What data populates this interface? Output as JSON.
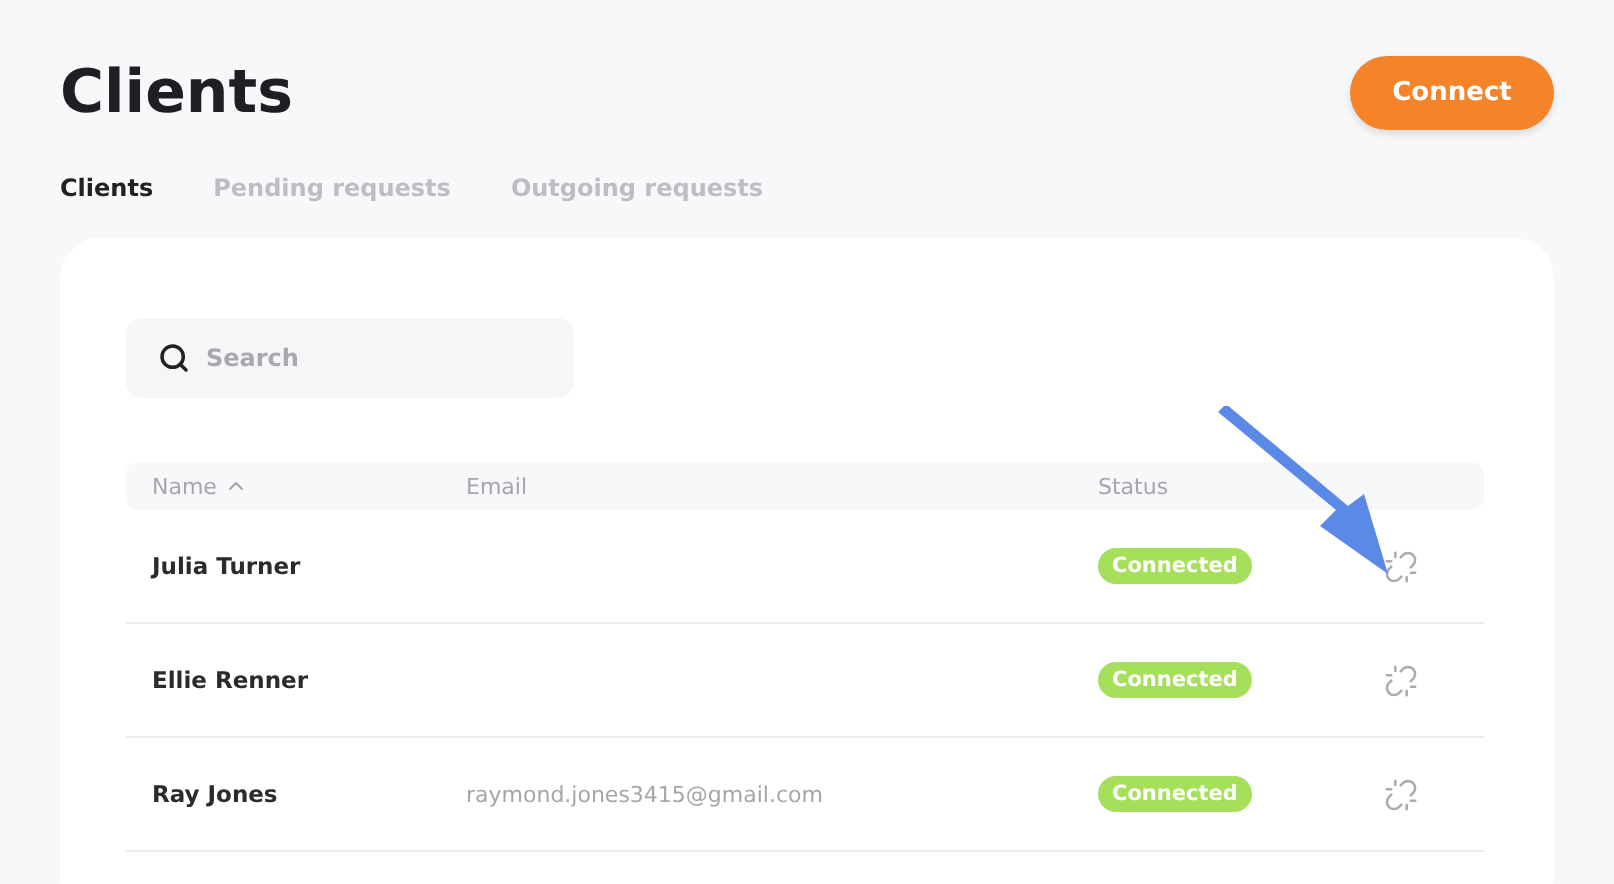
{
  "page": {
    "title": "Clients"
  },
  "connect_button": "Connect",
  "tabs": [
    {
      "label": "Clients",
      "selected": true
    },
    {
      "label": "Pending requests",
      "selected": false
    },
    {
      "label": "Outgoing requests",
      "selected": false
    }
  ],
  "search": {
    "placeholder": "Search"
  },
  "table": {
    "columns": [
      {
        "label": "Name",
        "sorted": true
      },
      {
        "label": "Email",
        "sorted": false
      },
      {
        "label": "Status",
        "sorted": false
      }
    ],
    "rows": [
      {
        "name": "Julia Turner",
        "status": "Connected"
      },
      {
        "name": "Ellie Renner",
        "status": "Connected"
      },
      {
        "name": "Ray Jones",
        "email": "raymond.jones3415@gmail.com",
        "status": "Connected"
      }
    ]
  },
  "callout_arrow": {
    "kind": "arrow"
  }
}
